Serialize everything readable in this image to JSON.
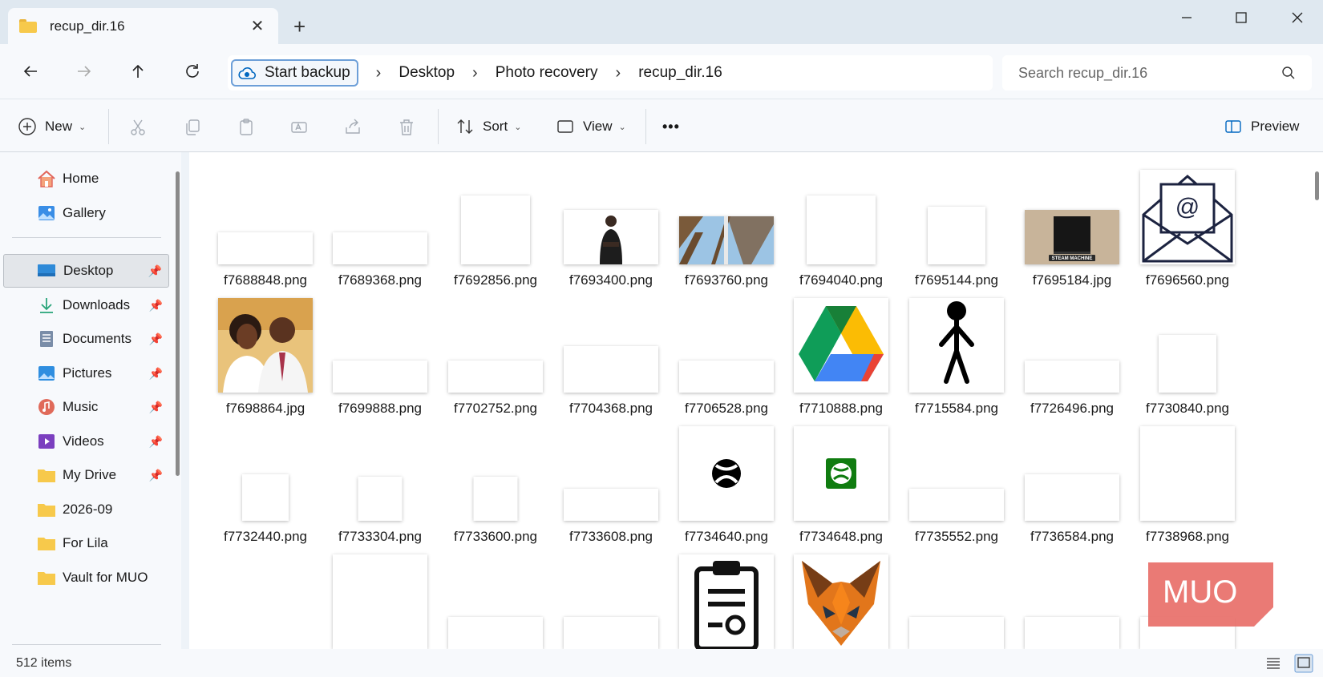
{
  "window": {
    "tab_title": "recup_dir.16",
    "new_tab": "+"
  },
  "address": {
    "backup_label": "Start backup",
    "crumbs": [
      "Desktop",
      "Photo recovery",
      "recup_dir.16"
    ],
    "search_placeholder": "Search recup_dir.16"
  },
  "toolbar": {
    "new_label": "New",
    "sort_label": "Sort",
    "view_label": "View",
    "more_label": "•••",
    "preview_label": "Preview"
  },
  "sidebar": {
    "top": [
      {
        "label": "Home",
        "icon": "home-icon"
      },
      {
        "label": "Gallery",
        "icon": "gallery-icon"
      }
    ],
    "quick_access": [
      {
        "label": "Desktop",
        "icon": "desktop-icon",
        "pinned": true,
        "selected": true
      },
      {
        "label": "Downloads",
        "icon": "downloads-icon",
        "pinned": true
      },
      {
        "label": "Documents",
        "icon": "documents-icon",
        "pinned": true
      },
      {
        "label": "Pictures",
        "icon": "pictures-icon",
        "pinned": true
      },
      {
        "label": "Music",
        "icon": "music-icon",
        "pinned": true
      },
      {
        "label": "Videos",
        "icon": "videos-icon",
        "pinned": true
      },
      {
        "label": "My Drive",
        "icon": "folder-icon",
        "pinned": true
      },
      {
        "label": "2026-09",
        "icon": "folder-icon",
        "pinned": false
      },
      {
        "label": "For Lila",
        "icon": "folder-icon",
        "pinned": false
      },
      {
        "label": "Vault for MUO",
        "icon": "folder-icon",
        "pinned": false
      }
    ]
  },
  "files": [
    {
      "name": "f7688848.png",
      "thumb": "blank"
    },
    {
      "name": "f7689368.png",
      "thumb": "blank"
    },
    {
      "name": "f7692856.png",
      "thumb": "blank"
    },
    {
      "name": "f7693400.png",
      "thumb": "person"
    },
    {
      "name": "f7693760.png",
      "thumb": "windows"
    },
    {
      "name": "f7694040.png",
      "thumb": "blank"
    },
    {
      "name": "f7695144.png",
      "thumb": "blank"
    },
    {
      "name": "f7695184.jpg",
      "thumb": "steam",
      "caption": "STEAM MACHINE"
    },
    {
      "name": "f7696560.png",
      "thumb": "email"
    },
    {
      "name": "f7698864.jpg",
      "thumb": "couple"
    },
    {
      "name": "f7699888.png",
      "thumb": "blank"
    },
    {
      "name": "f7702752.png",
      "thumb": "blank"
    },
    {
      "name": "f7704368.png",
      "thumb": "blank"
    },
    {
      "name": "f7706528.png",
      "thumb": "blank"
    },
    {
      "name": "f7710888.png",
      "thumb": "drive"
    },
    {
      "name": "f7715584.png",
      "thumb": "stickman"
    },
    {
      "name": "f7726496.png",
      "thumb": "blank"
    },
    {
      "name": "f7730840.png",
      "thumb": "blank"
    },
    {
      "name": "f7732440.png",
      "thumb": "blank"
    },
    {
      "name": "f7733304.png",
      "thumb": "blank"
    },
    {
      "name": "f7733600.png",
      "thumb": "blank"
    },
    {
      "name": "f7733608.png",
      "thumb": "blank"
    },
    {
      "name": "f7734640.png",
      "thumb": "xbox-black"
    },
    {
      "name": "f7734648.png",
      "thumb": "xbox-green"
    },
    {
      "name": "f7735552.png",
      "thumb": "blank"
    },
    {
      "name": "f7736584.png",
      "thumb": "blank"
    },
    {
      "name": "f7738968.png",
      "thumb": "blank"
    },
    {
      "name": "",
      "thumb": "none"
    },
    {
      "name": "",
      "thumb": "blank"
    },
    {
      "name": "",
      "thumb": "blank"
    },
    {
      "name": "",
      "thumb": "blank"
    },
    {
      "name": "",
      "thumb": "clipboard"
    },
    {
      "name": "",
      "thumb": "fox"
    },
    {
      "name": "",
      "thumb": "blank"
    },
    {
      "name": "",
      "thumb": "blank"
    },
    {
      "name": "",
      "thumb": "blank"
    }
  ],
  "status": {
    "item_count": "512 items"
  },
  "watermark": "MUO",
  "colors": {
    "accent": "#0067c0",
    "folder": "#f7c94b",
    "selected_bg": "#e3e6ea",
    "watermark": "#e8706a"
  }
}
